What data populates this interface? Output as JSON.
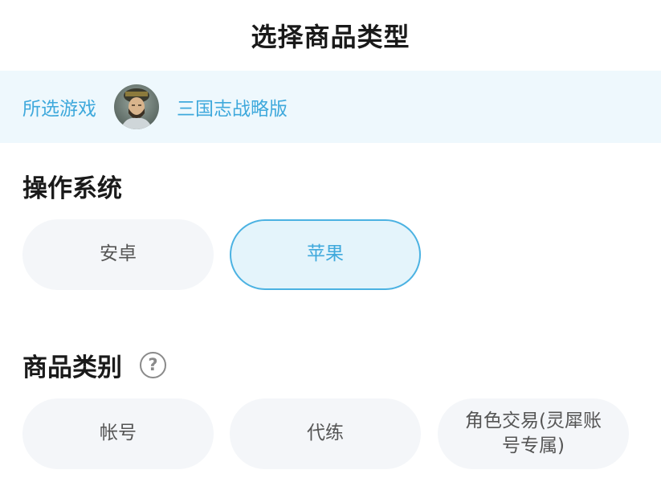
{
  "header": {
    "title": "选择商品类型"
  },
  "game_bar": {
    "label": "所选游戏",
    "avatar_icon": "game-avatar",
    "game_name": "三国志战略版"
  },
  "os_section": {
    "title": "操作系统",
    "options": [
      {
        "label": "安卓",
        "selected": false
      },
      {
        "label": "苹果",
        "selected": true
      }
    ]
  },
  "category_section": {
    "title": "商品类别",
    "help_icon": "question-circle-icon",
    "help_glyph": "?",
    "options": [
      {
        "label": "帐号",
        "selected": false
      },
      {
        "label": "代练",
        "selected": false
      },
      {
        "label": "角色交易(灵犀账号专属)",
        "selected": false
      }
    ]
  },
  "colors": {
    "accent": "#3fa9dc",
    "accent_bg": "#eef8fd",
    "option_bg": "#f4f6f9"
  }
}
